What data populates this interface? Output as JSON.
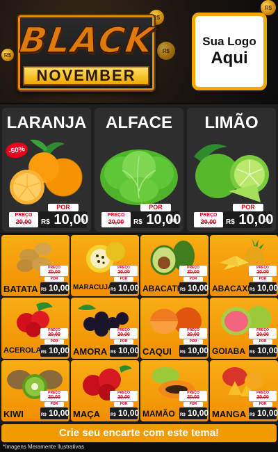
{
  "header": {
    "banner_line1": "BLACK",
    "banner_line2": "NOVEMBER",
    "coin_label": "R$",
    "logo_line1": "Sua Logo",
    "logo_line2": "Aqui"
  },
  "price_labels": {
    "preco": "PREÇO",
    "por": "POR",
    "currency": "R$"
  },
  "featured": [
    {
      "name": "LARANJA",
      "old_price": "20,00",
      "price": "10,00",
      "unit": "KG",
      "badge": "-50%",
      "icon": "orange-icon"
    },
    {
      "name": "ALFACE",
      "old_price": "20,00",
      "price": "10,00",
      "unit": "UNID",
      "icon": "lettuce-icon"
    },
    {
      "name": "LIMÃO",
      "old_price": "20,00",
      "price": "10,00",
      "unit": "KG",
      "icon": "lime-icon"
    }
  ],
  "products": [
    {
      "name": "BATATA",
      "old_price": "20,00",
      "price": "10,00",
      "icon": "potato-icon"
    },
    {
      "name": "MARACUJÁ",
      "old_price": "20,00",
      "price": "10,00",
      "icon": "passion-fruit-icon"
    },
    {
      "name": "ABACATE",
      "old_price": "20,00",
      "price": "10,00",
      "icon": "avocado-icon"
    },
    {
      "name": "ABACAXI",
      "old_price": "20,00",
      "price": "10,00",
      "icon": "pineapple-icon"
    },
    {
      "name": "ACEROLA",
      "old_price": "20,00",
      "price": "10,00",
      "icon": "acerola-icon"
    },
    {
      "name": "AMORA",
      "old_price": "20,00",
      "price": "10,00",
      "icon": "blackberry-icon"
    },
    {
      "name": "CAQUI",
      "old_price": "20,00",
      "price": "10,00",
      "icon": "persimmon-icon"
    },
    {
      "name": "GOIABA",
      "old_price": "20,00",
      "price": "10,00",
      "icon": "guava-icon"
    },
    {
      "name": "KIWI",
      "old_price": "20,00",
      "price": "10,00",
      "icon": "kiwi-icon"
    },
    {
      "name": "MAÇA",
      "old_price": "20,00",
      "price": "10,00",
      "icon": "apple-icon"
    },
    {
      "name": "MAMÃO",
      "old_price": "20,00",
      "price": "10,00",
      "icon": "papaya-icon"
    },
    {
      "name": "MANGA",
      "old_price": "20,00",
      "price": "10,00",
      "icon": "mango-icon"
    }
  ],
  "footer": {
    "cta": "Crie seu encarte com este tema!",
    "disclaimer": "*Imagens Meramente Ilustrativas"
  },
  "colors": {
    "accent": "#f29a00",
    "price_red": "#e5001c",
    "card_bg": "#f9ad15",
    "dark": "#1c1c1c"
  }
}
